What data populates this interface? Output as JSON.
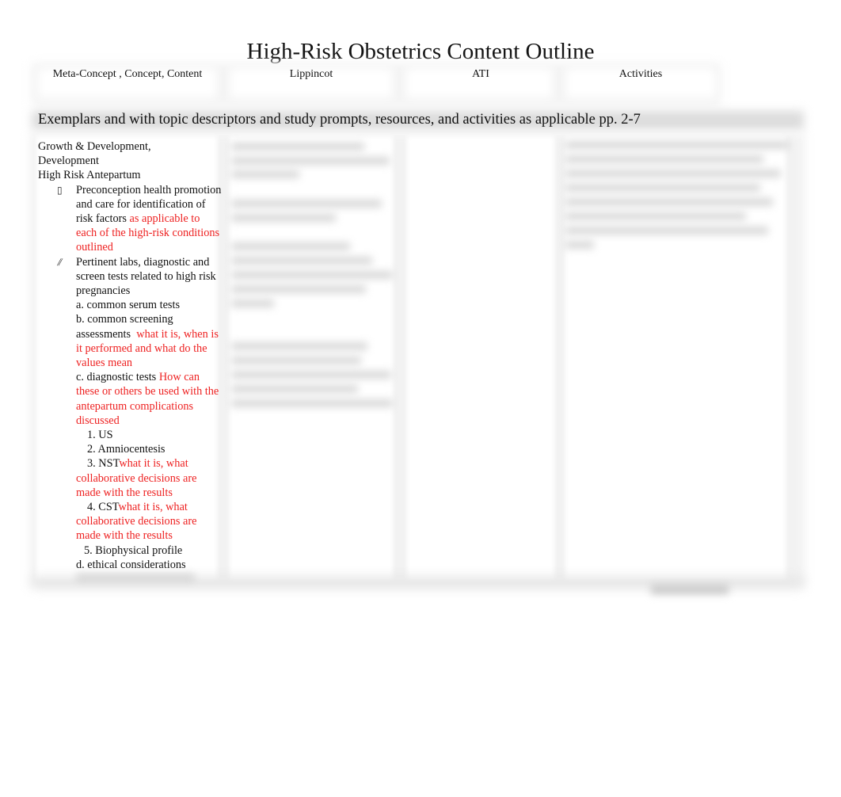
{
  "document": {
    "title": "High-Risk Obstetrics Content Outline",
    "table_headers": {
      "col1": "Meta-Concept , Concept, Content",
      "col2": "Lippincot",
      "col3": "ATI",
      "col4": "Activities"
    },
    "exemplars_row": "Exemplars and with topic descriptors and study prompts, resources, and activities as applicable pp. 2-7",
    "content_column": {
      "concept_line1": "Growth & Development,",
      "concept_line2": "Development",
      "section_heading": "High Risk Antepartum",
      "bullet1": {
        "icon": "bullet-box-icon",
        "glyph": "▯",
        "text": "Preconception health promotion and care for identification of risk factors",
        "prompt": "as applicable to each of the high-risk conditions outlined"
      },
      "bullet2": {
        "icon": "bullet-slash-icon",
        "glyph": "⫽",
        "text": "Pertinent labs, diagnostic and screen tests  related to high risk pregnancies"
      },
      "sub_a": "a. common serum tests",
      "sub_b": {
        "text": "b. common screening assessments",
        "prompt": "what it is, when is it performed and what do the values mean"
      },
      "sub_c": {
        "text": "c. diagnostic tests",
        "prompt": "How can these or others be used with the antepartum complications discussed"
      },
      "tests": [
        {
          "label": "1. US",
          "prompt": ""
        },
        {
          "label": "2. Amniocentesis",
          "prompt": ""
        },
        {
          "label": "3. NST",
          "prompt": "what it is, what collaborative decisions are made with the results"
        },
        {
          "label": "4. CST",
          "prompt": "what it is, what collaborative decisions are made with the results"
        },
        {
          "label": "5. Biophysical profile",
          "prompt": ""
        }
      ],
      "sub_d": "d. ethical considerations"
    },
    "colors": {
      "prompt_red": "#ee2222",
      "text": "#111111"
    }
  }
}
